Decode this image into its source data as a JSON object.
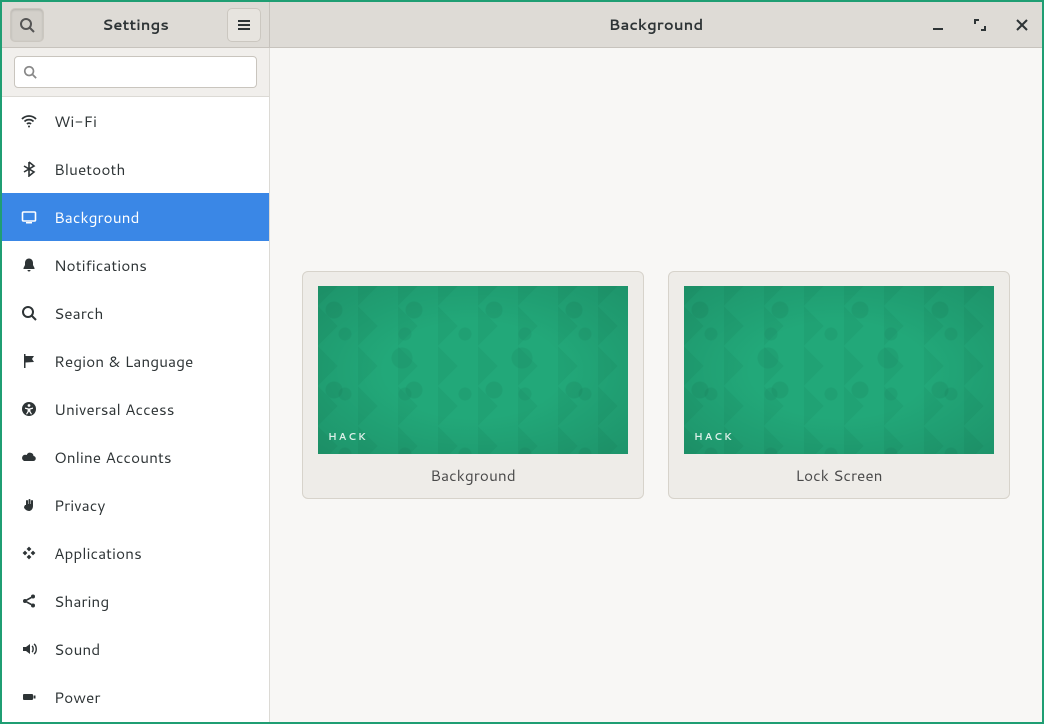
{
  "header": {
    "sidebar_title": "Settings",
    "main_title": "Background"
  },
  "search": {
    "placeholder": ""
  },
  "sidebar": {
    "items": [
      {
        "id": "wifi",
        "label": "Wi-Fi",
        "icon": "wifi-icon",
        "selected": false
      },
      {
        "id": "bluetooth",
        "label": "Bluetooth",
        "icon": "bluetooth-icon",
        "selected": false
      },
      {
        "id": "background",
        "label": "Background",
        "icon": "background-icon",
        "selected": true
      },
      {
        "id": "notifications",
        "label": "Notifications",
        "icon": "bell-icon",
        "selected": false
      },
      {
        "id": "search",
        "label": "Search",
        "icon": "search-icon",
        "selected": false
      },
      {
        "id": "region",
        "label": "Region & Language",
        "icon": "flag-icon",
        "selected": false
      },
      {
        "id": "universal",
        "label": "Universal Access",
        "icon": "accessibility-icon",
        "selected": false
      },
      {
        "id": "online",
        "label": "Online Accounts",
        "icon": "cloud-icon",
        "selected": false
      },
      {
        "id": "privacy",
        "label": "Privacy",
        "icon": "hand-icon",
        "selected": false
      },
      {
        "id": "applications",
        "label": "Applications",
        "icon": "apps-icon",
        "selected": false
      },
      {
        "id": "sharing",
        "label": "Sharing",
        "icon": "share-icon",
        "selected": false
      },
      {
        "id": "sound",
        "label": "Sound",
        "icon": "sound-icon",
        "selected": false
      },
      {
        "id": "power",
        "label": "Power",
        "icon": "power-icon",
        "selected": false
      }
    ]
  },
  "main": {
    "tiles": [
      {
        "label": "Background",
        "watermark": "HACK"
      },
      {
        "label": "Lock Screen",
        "watermark": "HACK"
      }
    ]
  },
  "colors": {
    "accent": "#3a87e6",
    "wallpaper": "#22a879"
  }
}
